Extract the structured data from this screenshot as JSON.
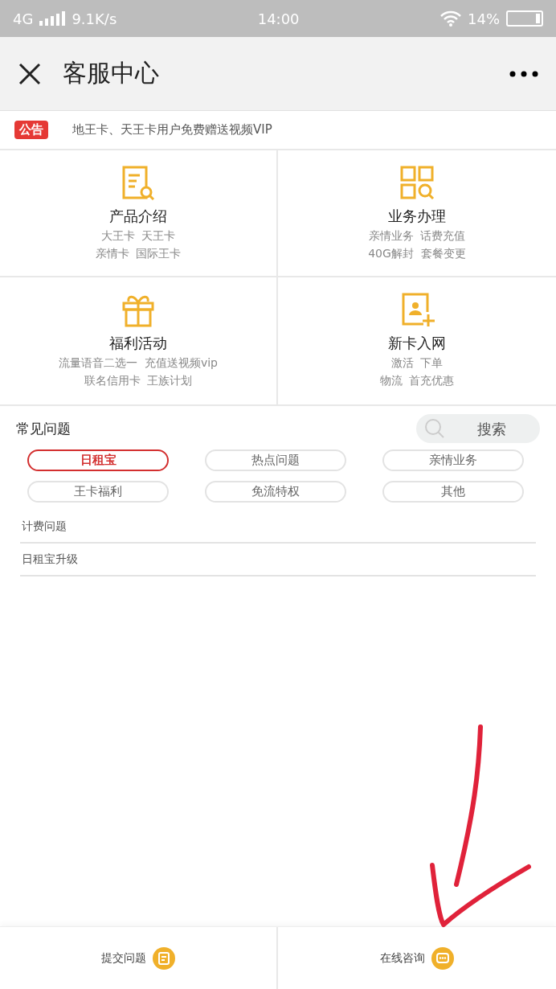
{
  "status_bar": {
    "network": "4G",
    "speed": "9.1K/s",
    "time": "14:00",
    "battery": "14%"
  },
  "header": {
    "title": "客服中心"
  },
  "notice": {
    "badge": "公告",
    "text": "地王卡、天王卡用户免费赠送视频VIP"
  },
  "services": [
    {
      "kind": "document",
      "title": "产品介绍",
      "lines": [
        "大王卡  天王卡",
        "亲情卡  国际王卡"
      ]
    },
    {
      "kind": "grid",
      "title": "业务办理",
      "lines": [
        "亲情业务  话费充值",
        "40G解封  套餐变更"
      ]
    },
    {
      "kind": "gift",
      "title": "福利活动",
      "lines": [
        "流量语音二选一  充值送视频vip",
        "联名信用卡  王族计划"
      ]
    },
    {
      "kind": "newcard",
      "title": "新卡入网",
      "lines": [
        "激活  下单",
        "物流  首充优惠"
      ]
    }
  ],
  "faq": {
    "title": "常见问题",
    "search": {
      "placeholder": "搜索"
    },
    "tabs": [
      {
        "label": "日租宝",
        "selected": true
      },
      {
        "label": "热点问题",
        "selected": false
      },
      {
        "label": "亲情业务",
        "selected": false
      },
      {
        "label": "王卡福利",
        "selected": false
      },
      {
        "label": "免流特权",
        "selected": false
      },
      {
        "label": "其他",
        "selected": false
      }
    ],
    "items": [
      "计费问题",
      "日租宝升级"
    ]
  },
  "bottom_bar": [
    {
      "kind": "submit",
      "label": "提交问题"
    },
    {
      "kind": "chat",
      "label": "在线咨询"
    }
  ]
}
